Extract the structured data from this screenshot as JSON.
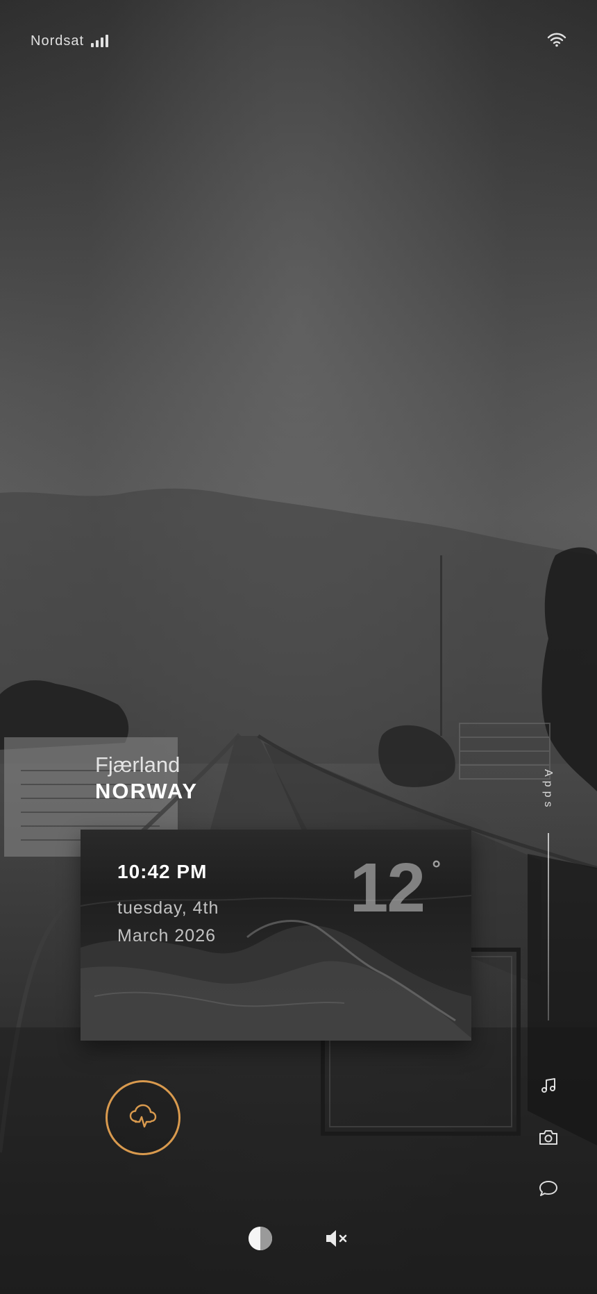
{
  "status_bar": {
    "carrier": "Nordsat",
    "signal_icon": "signal-bars-icon",
    "wifi_icon": "wifi-icon"
  },
  "location": {
    "city": "Fjærland",
    "country": "NORWAY"
  },
  "weather_card": {
    "time": "10:42 PM",
    "day": "tuesday, 4th",
    "month_year": "March 2026",
    "temperature": "12",
    "degree_symbol": "°"
  },
  "apps_rail": {
    "label": "Apps",
    "items": [
      {
        "icon": "music-note-icon"
      },
      {
        "icon": "camera-icon"
      },
      {
        "icon": "chat-bubble-icon"
      }
    ]
  },
  "weather_button": {
    "icon": "cloud-weather-icon",
    "accent_color": "#d99a4e"
  },
  "bottom_controls": [
    {
      "icon": "contrast-icon"
    },
    {
      "icon": "mute-icon"
    }
  ]
}
